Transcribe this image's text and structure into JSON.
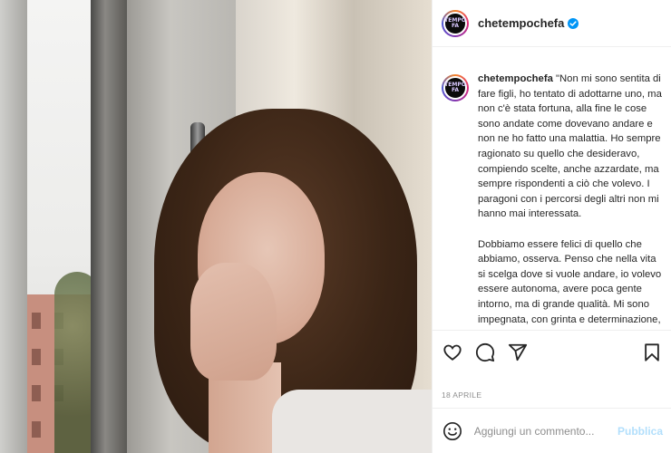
{
  "post": {
    "username": "chetempochefa",
    "avatar_text_top": "TEMPO",
    "avatar_text_bottom": "FA",
    "verified_icon": "verified-badge-icon",
    "accent_color": "#0095f6"
  },
  "caption": {
    "username": "chetempochefa",
    "paragraph1": "\"Non mi sono sentita di fare figli, ho tentato di adottarne uno, ma non c'è stata fortuna, alla fine le cose sono andate come dovevano andare e non ne ho fatto una malattia. Ho sempre ragionato su quello che desideravo, compiendo scelte, anche azzardate, ma sempre rispondenti a ciò che volevo. I paragoni con i percorsi degli altri non mi hanno mai interessata.",
    "paragraph2": "Dobbiamo essere felici di quello che abbiamo, osserva. Penso che nella vita si scelga dove si vuole andare, io volevo essere autonoma, avere poca gente intorno, ma di grande qualità. Mi sono impegnata, con grinta e determinazione, e quello che non ho"
  },
  "actions": {
    "like_icon": "heart-icon",
    "comment_icon": "comment-icon",
    "share_icon": "share-icon",
    "save_icon": "bookmark-icon"
  },
  "date": "18 APRILE",
  "comment": {
    "emoji_icon": "emoji-icon",
    "placeholder": "Aggiungi un commento...",
    "publish_label": "Pubblica",
    "publish_color": "#b2dffc"
  }
}
